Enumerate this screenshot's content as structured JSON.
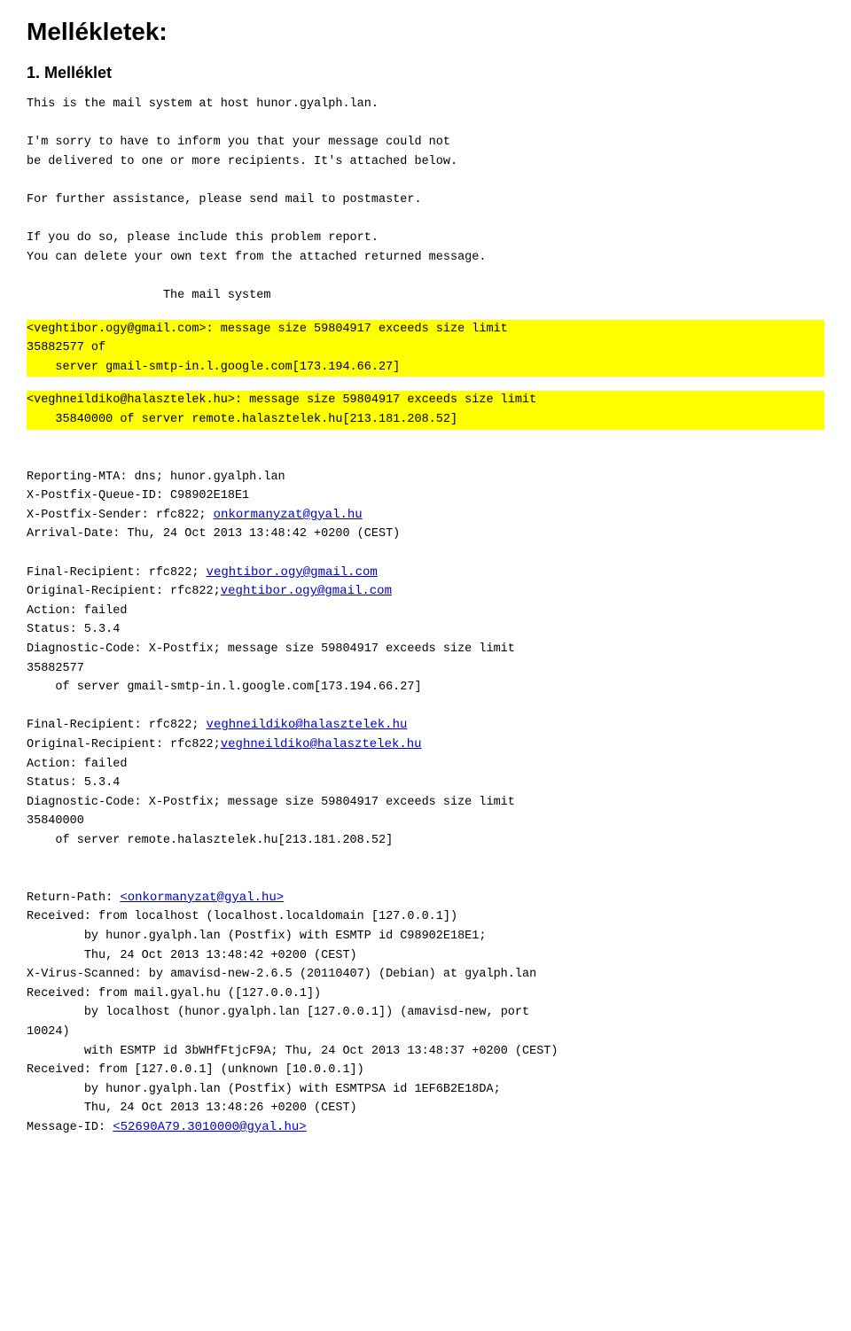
{
  "page": {
    "title": "Mellékletek:",
    "section1_heading": "1. Melléklet",
    "body_text_1": "This is the mail system at host hunor.gyalph.lan.\n\nI'm sorry to have to inform you that your message could not\nbe delivered to one or more recipients. It's attached below.\n\nFor further assistance, please send mail to postmaster.\n\nIf you do so, please include this problem report.\nYou can delete your own text from the attached returned message.\n\n                   The mail system",
    "highlighted_block_1": "<veghtibor.ogy@gmail.com>: message size 59804917 exceeds size limit\n35882577 of\n    server gmail-smtp-in.l.google.com[173.194.66.27]",
    "highlighted_block_2": "<veghneildiko@halasztelek.hu>: message size 59804917 exceeds size limit\n    35840000 of server remote.halasztelek.hu[213.181.208.52]",
    "body_text_2": "\n\nReporting-MTA: dns; hunor.gyalph.lan\nX-Postfix-Queue-ID: C98902E18E1\nX-Postfix-Sender: rfc822; ",
    "link_onkormanyzat": "onkormanyzat@gyal.hu",
    "body_text_3": "\nArrival-Date: Thu, 24 Oct 2013 13:48:42 +0200 (CEST)\n\nFinal-Recipient: rfc822; ",
    "link_veghtibor": "veghtibor.ogy@gmail.com",
    "body_text_4": "\nOriginal-Recipient: rfc822;",
    "link_veghtibor2": "veghtibor.ogy@gmail.com",
    "body_text_5": "\nAction: failed\nStatus: 5.3.4\nDiagnostic-Code: X-Postfix; message size 59804917 exceeds size limit\n35882577\n    of server gmail-smtp-in.l.google.com[173.194.66.27]\n\nFinal-Recipient: rfc822; ",
    "link_veghneildiko": "veghneildiko@halasztelek.hu",
    "body_text_6": "\nOriginal-Recipient: rfc822;",
    "link_veghneildiko2": "veghneildiko@halasztelek.hu",
    "body_text_7": "\nAction: failed\nStatus: 5.3.4\nDiagnostic-Code: X-Postfix; message size 59804917 exceeds size limit\n35840000\n    of server remote.halasztelek.hu[213.181.208.52]\n\n\nReturn-Path: ",
    "link_returnpath": "<onkormanyzat@gyal.hu>",
    "body_text_8": "\nReceived: from localhost (localhost.localdomain [127.0.0.1])\n        by hunor.gyalph.lan (Postfix) with ESMTP id C98902E18E1;\n        Thu, 24 Oct 2013 13:48:42 +0200 (CEST)\nX-Virus-Scanned: by amavisd-new-2.6.5 (20110407) (Debian) at gyalph.lan\nReceived: from mail.gyal.hu ([127.0.0.1])\n        by localhost (hunor.gyalph.lan [127.0.0.1]) (amavisd-new, port\n10024)\n        with ESMTP id 3bWHfFtjcF9A; Thu, 24 Oct 2013 13:48:37 +0200 (CEST)\nReceived: from [127.0.0.1] (unknown [10.0.0.1])\n        by hunor.gyalph.lan (Postfix) with ESMTPSA id 1EF6B2E18DA;\n        Thu, 24 Oct 2013 13:48:26 +0200 (CEST)\nMessage-ID: ",
    "link_messageid": "<52690A79.3010000@gyal.hu>"
  }
}
